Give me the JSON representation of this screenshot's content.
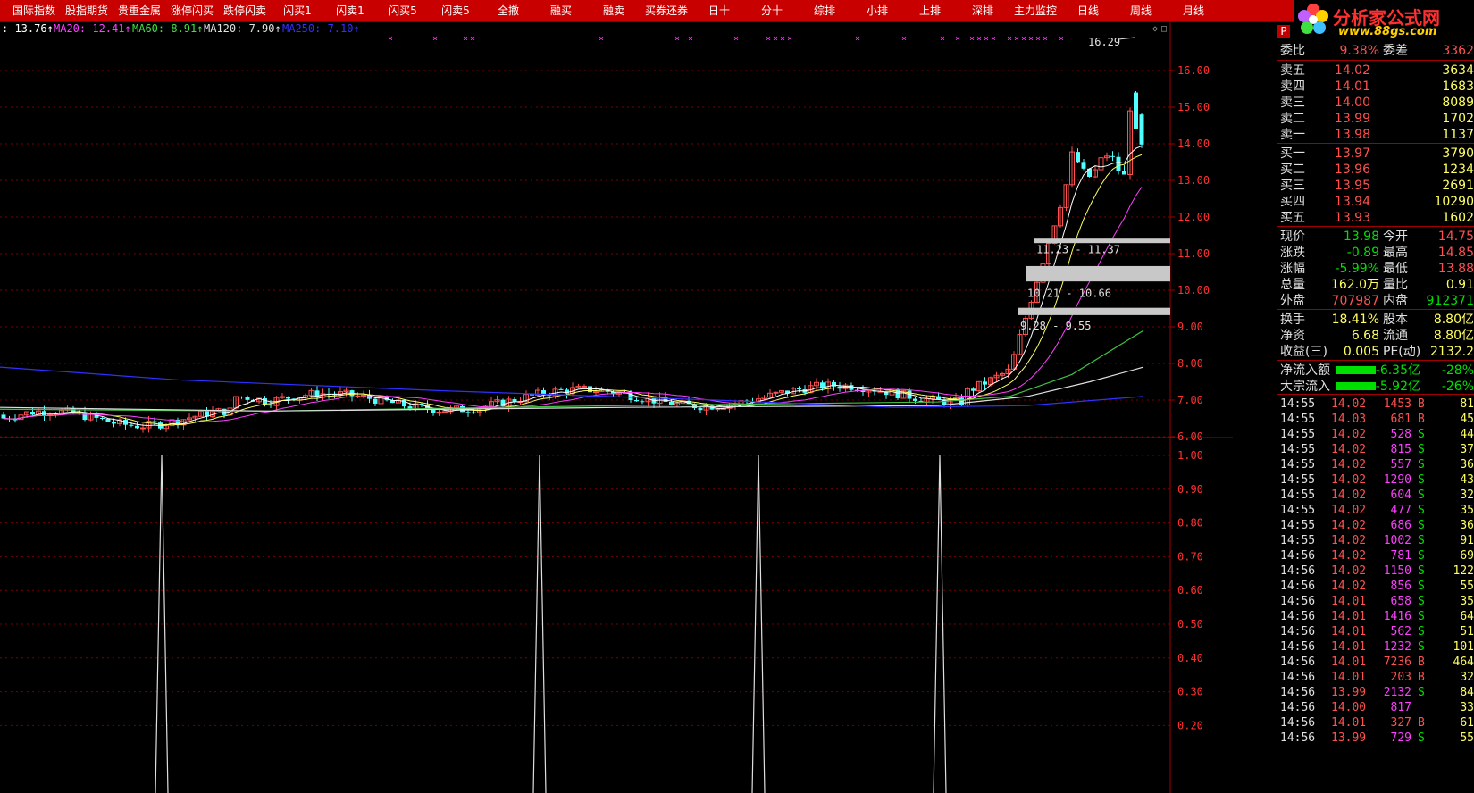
{
  "toolbar": {
    "buttons": [
      "国际指数",
      "股指期货",
      "贵重金属",
      "涨停闪买",
      "跌停闪卖",
      "闪买1",
      "闪卖1",
      "闪买5",
      "闪卖5",
      "全撤",
      "融买",
      "融卖",
      "买券还券",
      "日十",
      "分十",
      "综排",
      "小排",
      "上排",
      "深排",
      "主力监控",
      "日线",
      "周线",
      "月线"
    ]
  },
  "logo": {
    "title": "分析家公式网",
    "url": "www.88gs.com"
  },
  "ma_legend": {
    "close": ": 13.76↑",
    "ma20": "MA20: 12.41↑",
    "ma60": "MA60: 8.91↑",
    "ma120": "MA120: 7.90↑",
    "ma250": "MA250: 7.10↑"
  },
  "colors": {
    "up": "#ff5050",
    "down": "#50ffff",
    "ma20": "#ff40ff",
    "ma60": "#40c040",
    "ma120": "#d0d0d0",
    "ma250": "#3030ff",
    "grid": "#a00000"
  },
  "price_axis": [
    "16.00",
    "15.00",
    "14.00",
    "13.00",
    "12.00",
    "11.00",
    "10.00",
    "9.00",
    "8.00",
    "7.00",
    "6.00"
  ],
  "indicator_axis": [
    "1.00",
    "0.90",
    "0.80",
    "0.70",
    "0.60",
    "0.50",
    "0.40",
    "0.30",
    "0.20"
  ],
  "annotations": {
    "high_label": "16.29",
    "zones": [
      "11.23 - 11.37",
      "10.21 - 10.66",
      "9.28 - 9.55"
    ]
  },
  "quote": {
    "weibi_label": "委比",
    "weibi_value": "9.38%",
    "weicha_label": "委差",
    "weicha_value": "3362",
    "asks": [
      {
        "label": "卖五",
        "price": "14.02",
        "vol": "3634"
      },
      {
        "label": "卖四",
        "price": "14.01",
        "vol": "1683"
      },
      {
        "label": "卖三",
        "price": "14.00",
        "vol": "8089"
      },
      {
        "label": "卖二",
        "price": "13.99",
        "vol": "1702"
      },
      {
        "label": "卖一",
        "price": "13.98",
        "vol": "1137"
      }
    ],
    "bids": [
      {
        "label": "买一",
        "price": "13.97",
        "vol": "3790"
      },
      {
        "label": "买二",
        "price": "13.96",
        "vol": "1234"
      },
      {
        "label": "买三",
        "price": "13.95",
        "vol": "2691"
      },
      {
        "label": "买四",
        "price": "13.94",
        "vol": "10290"
      },
      {
        "label": "买五",
        "price": "13.93",
        "vol": "1602"
      }
    ],
    "stats": [
      {
        "l1": "现价",
        "v1": "13.98",
        "l2": "今开",
        "v2": "14.75"
      },
      {
        "l1": "涨跌",
        "v1": "-0.89",
        "l2": "最高",
        "v2": "14.85"
      },
      {
        "l1": "涨幅",
        "v1": "-5.99%",
        "l2": "最低",
        "v2": "13.88"
      },
      {
        "l1": "总量",
        "v1": "162.0万",
        "l2": "量比",
        "v2": "0.91"
      },
      {
        "l1": "外盘",
        "v1": "707987",
        "l2": "内盘",
        "v2": "912371"
      }
    ],
    "fund": [
      {
        "l1": "换手",
        "v1": "18.41%",
        "l2": "股本",
        "v2": "8.80亿"
      },
      {
        "l1": "净资",
        "v1": "6.68",
        "l2": "流通",
        "v2": "8.80亿"
      },
      {
        "l1": "收益(三)",
        "v1": "0.005",
        "l2": "PE(动)",
        "v2": "2132.2"
      }
    ],
    "flow": [
      {
        "label": "净流入额",
        "value": "-6.35亿",
        "pct": "-28%"
      },
      {
        "label": "大宗流入",
        "value": "-5.92亿",
        "pct": "-26%"
      }
    ]
  },
  "ticks": [
    {
      "t": "14:55",
      "p": "14.02",
      "v": "1453",
      "s": "B",
      "n": "81"
    },
    {
      "t": "14:55",
      "p": "14.03",
      "v": "681",
      "s": "B",
      "n": "45"
    },
    {
      "t": "14:55",
      "p": "14.02",
      "v": "528",
      "s": "S",
      "n": "44"
    },
    {
      "t": "14:55",
      "p": "14.02",
      "v": "815",
      "s": "S",
      "n": "37"
    },
    {
      "t": "14:55",
      "p": "14.02",
      "v": "557",
      "s": "S",
      "n": "36"
    },
    {
      "t": "14:55",
      "p": "14.02",
      "v": "1290",
      "s": "S",
      "n": "43"
    },
    {
      "t": "14:55",
      "p": "14.02",
      "v": "604",
      "s": "S",
      "n": "32"
    },
    {
      "t": "14:55",
      "p": "14.02",
      "v": "477",
      "s": "S",
      "n": "35"
    },
    {
      "t": "14:55",
      "p": "14.02",
      "v": "686",
      "s": "S",
      "n": "36"
    },
    {
      "t": "14:55",
      "p": "14.02",
      "v": "1002",
      "s": "S",
      "n": "91"
    },
    {
      "t": "14:56",
      "p": "14.02",
      "v": "781",
      "s": "S",
      "n": "69"
    },
    {
      "t": "14:56",
      "p": "14.02",
      "v": "1150",
      "s": "S",
      "n": "122"
    },
    {
      "t": "14:56",
      "p": "14.02",
      "v": "856",
      "s": "S",
      "n": "55"
    },
    {
      "t": "14:56",
      "p": "14.01",
      "v": "658",
      "s": "S",
      "n": "35"
    },
    {
      "t": "14:56",
      "p": "14.01",
      "v": "1416",
      "s": "S",
      "n": "64"
    },
    {
      "t": "14:56",
      "p": "14.01",
      "v": "562",
      "s": "S",
      "n": "51"
    },
    {
      "t": "14:56",
      "p": "14.01",
      "v": "1232",
      "s": "S",
      "n": "101"
    },
    {
      "t": "14:56",
      "p": "14.01",
      "v": "7236",
      "s": "B",
      "n": "464"
    },
    {
      "t": "14:56",
      "p": "14.01",
      "v": "203",
      "s": "B",
      "n": "32"
    },
    {
      "t": "14:56",
      "p": "13.99",
      "v": "2132",
      "s": "S",
      "n": "84"
    },
    {
      "t": "14:56",
      "p": "14.00",
      "v": "817",
      "s": "",
      "n": "33"
    },
    {
      "t": "14:56",
      "p": "14.01",
      "v": "327",
      "s": "B",
      "n": "61"
    },
    {
      "t": "14:56",
      "p": "13.99",
      "v": "729",
      "s": "S",
      "n": "55"
    }
  ]
}
